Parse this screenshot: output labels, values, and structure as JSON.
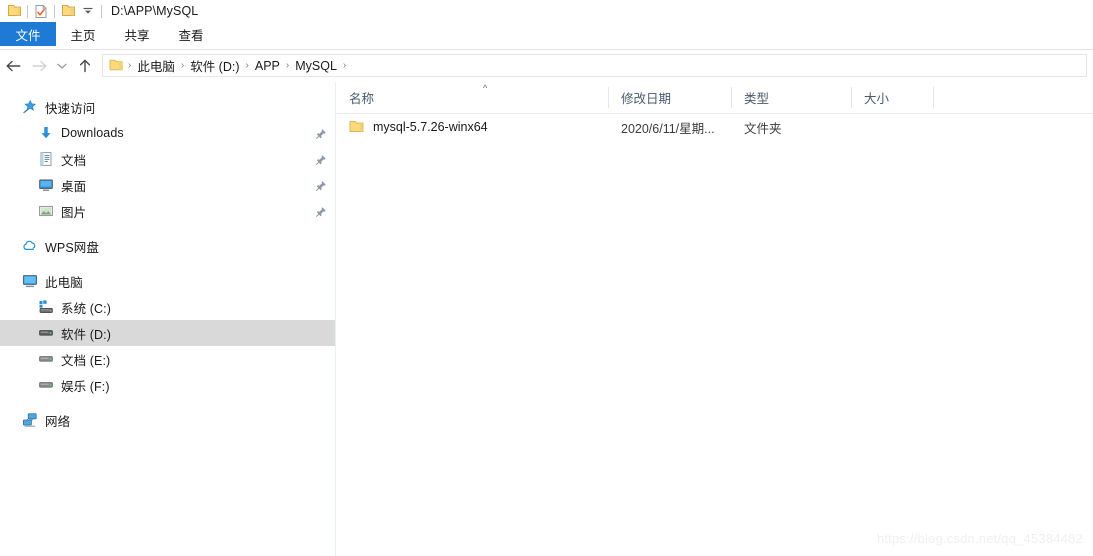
{
  "window": {
    "title_path": "D:\\APP\\MySQL",
    "quick_access_toolbar": [
      {
        "name": "folder-icon",
        "label": "属性"
      },
      {
        "name": "properties-icon",
        "label": "属性"
      },
      {
        "name": "new-folder-icon",
        "label": "新建文件夹"
      },
      {
        "name": "chevron-down-icon",
        "label": "自定义快速访问工具栏"
      }
    ]
  },
  "ribbon": {
    "tabs": [
      {
        "label": "文件",
        "active": true
      },
      {
        "label": "主页",
        "active": false
      },
      {
        "label": "共享",
        "active": false
      },
      {
        "label": "查看",
        "active": false
      }
    ]
  },
  "navbar": {
    "back_label": "后退",
    "forward_label": "前进",
    "recent_label": "最近浏览的位置",
    "up_label": "上移到上一级",
    "breadcrumbs": [
      "此电脑",
      "软件 (D:)",
      "APP",
      "MySQL"
    ],
    "separator": "›"
  },
  "sidebar": {
    "groups": [
      {
        "header": {
          "label": "快速访问",
          "icon": "quick-access-star-icon"
        },
        "items": [
          {
            "label": "Downloads",
            "icon": "downloads-arrow-icon",
            "pinned": true
          },
          {
            "label": "文档",
            "icon": "documents-icon",
            "pinned": true
          },
          {
            "label": "桌面",
            "icon": "desktop-icon",
            "pinned": true
          },
          {
            "label": "图片",
            "icon": "pictures-icon",
            "pinned": true
          }
        ]
      },
      {
        "header": {
          "label": "WPS网盘",
          "icon": "cloud-icon"
        },
        "items": []
      },
      {
        "header": {
          "label": "此电脑",
          "icon": "this-pc-monitor-icon"
        },
        "items": [
          {
            "label": "系统 (C:)",
            "icon": "system-drive-icon",
            "selected": false
          },
          {
            "label": "软件 (D:)",
            "icon": "drive-icon",
            "selected": true
          },
          {
            "label": "文档 (E:)",
            "icon": "drive-icon",
            "selected": false
          },
          {
            "label": "娱乐 (F:)",
            "icon": "drive-icon",
            "selected": false
          }
        ]
      },
      {
        "header": {
          "label": "网络",
          "icon": "network-icon"
        },
        "items": []
      }
    ]
  },
  "file_list": {
    "columns": [
      {
        "label": "名称",
        "sorted": "asc"
      },
      {
        "label": "修改日期",
        "sorted": null
      },
      {
        "label": "类型",
        "sorted": null
      },
      {
        "label": "大小",
        "sorted": null
      }
    ],
    "sort_indicator": "^",
    "rows": [
      {
        "name": "mysql-5.7.26-winx64",
        "date": "2020/6/11/星期...",
        "type": "文件夹",
        "size": "",
        "icon": "folder-icon"
      }
    ]
  },
  "watermark": {
    "text": "https://blog.csdn.net/qq_45384482"
  },
  "colors": {
    "accent_blue": "#1e7ad4",
    "selection_gray": "#d9d9d9",
    "folder_yellow": "#f8d775",
    "header_text": "#4a5a6a"
  }
}
